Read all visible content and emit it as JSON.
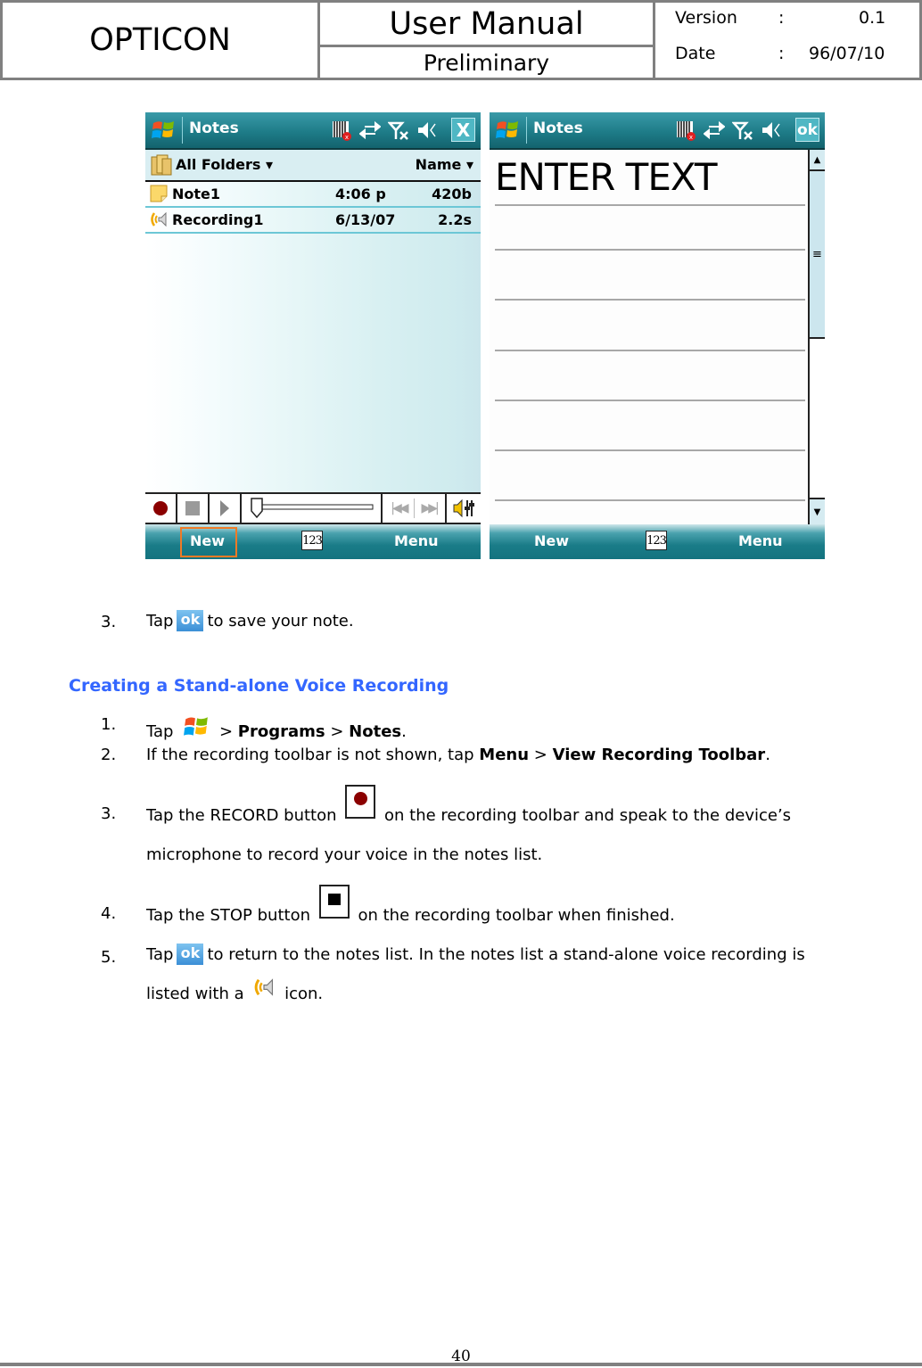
{
  "header": {
    "company": "OPTICON",
    "doc_title": "User Manual",
    "doc_status": "Preliminary",
    "version_label": "Version",
    "version_sep": ":",
    "version_value": "0.1",
    "date_label": "Date",
    "date_sep": ":",
    "date_value": "96/07/10"
  },
  "screen_list": {
    "title": "Notes",
    "close_label": "X",
    "folder_label": "All Folders",
    "sort_label": "Name",
    "items": [
      {
        "name": "Note1",
        "date": "4:06 p",
        "size": "420b",
        "icon": "note-icon"
      },
      {
        "name": "Recording1",
        "date": "6/13/07",
        "size": "2.2s",
        "icon": "voice-recording-icon"
      }
    ],
    "toolbar": [
      "record",
      "stop",
      "play",
      "position-slider",
      "previous",
      "next",
      "volume"
    ],
    "softkeys": {
      "left": "New",
      "center": "123",
      "right": "Menu"
    }
  },
  "screen_edit": {
    "title": "Notes",
    "ok_label": "ok",
    "note_text": "ENTER TEXT",
    "softkeys": {
      "left": "New",
      "center": "123",
      "right": "Menu"
    }
  },
  "body": {
    "step3_pre": {
      "num": "3.",
      "tap": "Tap",
      "ok": "ok",
      "rest": "to save your note."
    },
    "heading": "Creating a Stand-alone Voice Recording",
    "steps": [
      {
        "num": "1.",
        "t1": "Tap",
        "t2": ">",
        "b1": "Programs",
        "t3": ">",
        "b2": "Notes",
        "t4": "."
      },
      {
        "num": "2.",
        "t1": "If the recording toolbar is not shown, tap",
        "b1": "Menu",
        "t2": ">",
        "b2": "View Recording Toolbar",
        "t3": "."
      },
      {
        "num": "3.",
        "t1": "Tap the RECORD button",
        "t2": "on the recording toolbar and speak to the device’s",
        "t3": "microphone to record your voice in the notes list."
      },
      {
        "num": "4.",
        "t1": "Tap the STOP button",
        "t2": "on the recording toolbar when finished."
      },
      {
        "num": "5.",
        "t1": "Tap",
        "ok": "ok",
        "t2": "to return to the notes list. In the notes list a stand-alone voice recording is",
        "t3": "listed with a",
        "t4": "icon."
      }
    ]
  },
  "footer": {
    "page_number": "40"
  }
}
